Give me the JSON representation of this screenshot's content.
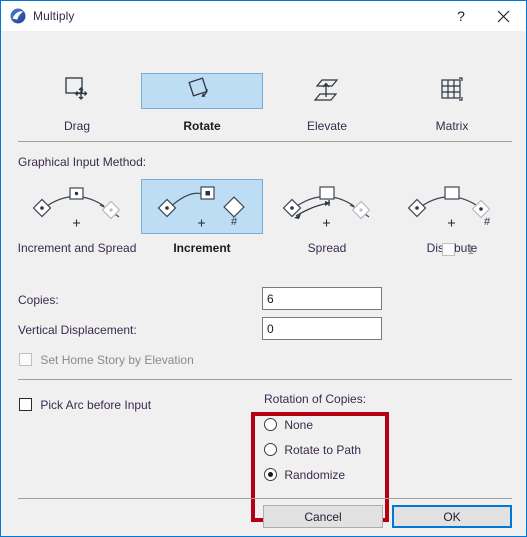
{
  "window": {
    "title": "Multiply",
    "icon": "app-swoosh-icon",
    "help_label": "?",
    "close_label": "✕",
    "accent_color": "#0078d7",
    "highlight_color": "#b50013",
    "selected_fill": "#bcddf4"
  },
  "modes": [
    {
      "label": "Drag",
      "icon": "drag-icon",
      "selected": false
    },
    {
      "label": "Rotate",
      "icon": "rotate-icon",
      "selected": true
    },
    {
      "label": "Elevate",
      "icon": "elevate-icon",
      "selected": false
    },
    {
      "label": "Matrix",
      "icon": "matrix-icon",
      "selected": false
    }
  ],
  "graphical_input": {
    "label": "Graphical Input Method:",
    "methods": [
      {
        "label": "Increment and Spread",
        "icon": "increment-and-spread-icon",
        "selected": false
      },
      {
        "label": "Increment",
        "icon": "increment-icon",
        "selected": true
      },
      {
        "label": "Spread",
        "icon": "spread-icon",
        "selected": false
      },
      {
        "label": "Distribute",
        "icon": "distribute-icon",
        "selected": false
      }
    ],
    "minus_one": {
      "label": "-1",
      "checked": false,
      "disabled": true
    }
  },
  "fields": {
    "copies": {
      "label": "Copies:",
      "value": "6",
      "placeholder": ""
    },
    "vertical_displacement": {
      "label": "Vertical Displacement:",
      "value": "0",
      "placeholder": ""
    },
    "set_home_story": {
      "label": "Set Home Story by Elevation",
      "checked": false,
      "disabled": true
    },
    "pick_arc": {
      "label": "Pick Arc before Input",
      "checked": false,
      "disabled": false
    }
  },
  "rotation_of_copies": {
    "label": "Rotation of Copies:",
    "options": [
      {
        "label": "None",
        "checked": false
      },
      {
        "label": "Rotate to Path",
        "checked": false
      },
      {
        "label": "Randomize",
        "checked": true
      }
    ]
  },
  "footer": {
    "cancel_label": "Cancel",
    "ok_label": "OK"
  }
}
